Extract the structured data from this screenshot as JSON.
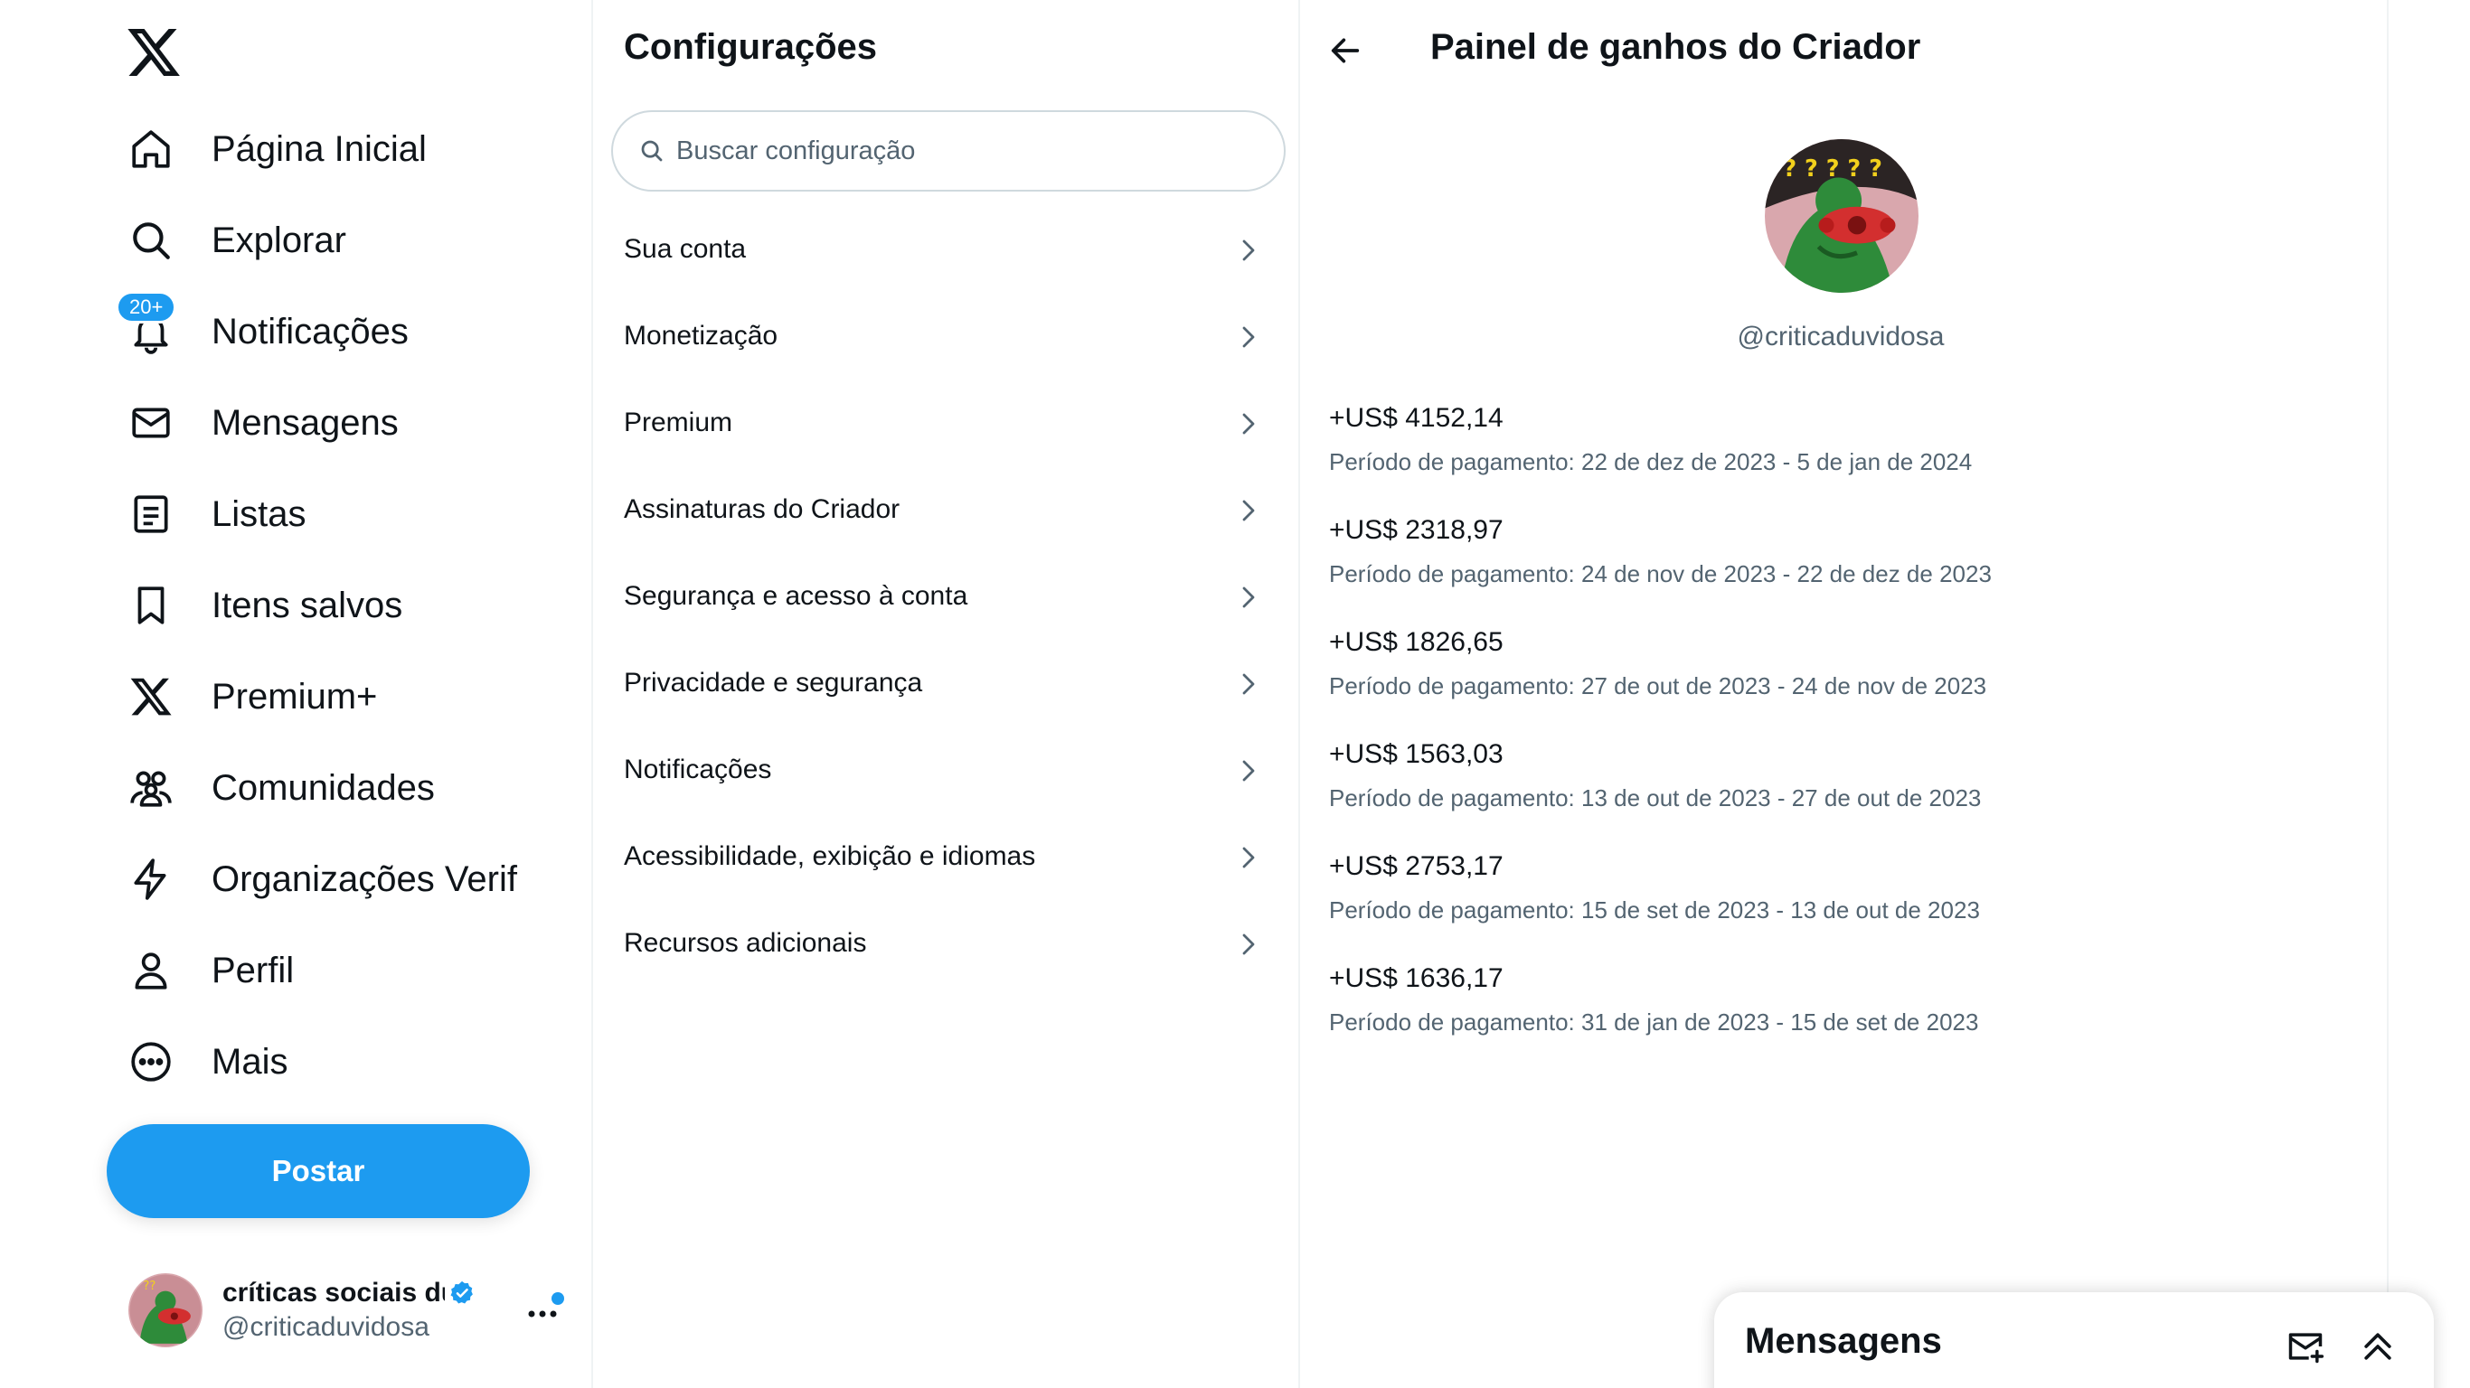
{
  "nav": {
    "items": [
      {
        "label": "Página Inicial",
        "icon": "home-icon"
      },
      {
        "label": "Explorar",
        "icon": "search-icon"
      },
      {
        "label": "Notificações",
        "icon": "bell-icon",
        "badge": "20+"
      },
      {
        "label": "Mensagens",
        "icon": "envelope-icon"
      },
      {
        "label": "Listas",
        "icon": "list-icon"
      },
      {
        "label": "Itens salvos",
        "icon": "bookmark-icon"
      },
      {
        "label": "Premium+",
        "icon": "x-logo-icon"
      },
      {
        "label": "Comunidades",
        "icon": "people-icon"
      },
      {
        "label": "Organizações Verif",
        "icon": "lightning-icon"
      },
      {
        "label": "Perfil",
        "icon": "person-icon"
      },
      {
        "label": "Mais",
        "icon": "more-circle-icon"
      }
    ],
    "post_label": "Postar",
    "account": {
      "display_name": "críticas sociais duvidosas",
      "handle": "@criticaduvidosa"
    }
  },
  "settings": {
    "title": "Configurações",
    "search_placeholder": "Buscar configuração",
    "items": [
      "Sua conta",
      "Monetização",
      "Premium",
      "Assinaturas do Criador",
      "Segurança e acesso à conta",
      "Privacidade e segurança",
      "Notificações",
      "Acessibilidade, exibição e idiomas",
      "Recursos adicionais"
    ]
  },
  "panel": {
    "title": "Painel de ganhos do Criador",
    "handle": "@criticaduvidosa",
    "earnings": [
      {
        "amount": "+US$ 4152,14",
        "period": "Período de pagamento: 22 de dez de 2023 - 5 de jan de 2024"
      },
      {
        "amount": "+US$ 2318,97",
        "period": "Período de pagamento: 24 de nov de 2023 - 22 de dez de 2023"
      },
      {
        "amount": "+US$ 1826,65",
        "period": "Período de pagamento: 27 de out de 2023 - 24 de nov de 2023"
      },
      {
        "amount": "+US$ 1563,03",
        "period": "Período de pagamento: 13 de out de 2023 - 27 de out de 2023"
      },
      {
        "amount": "+US$ 2753,17",
        "period": "Período de pagamento: 15 de set de 2023 - 13 de out de 2023"
      },
      {
        "amount": "+US$ 1636,17",
        "period": "Período de pagamento: 31 de jan de 2023 - 15 de set de 2023"
      }
    ]
  },
  "drawer": {
    "title": "Mensagens"
  },
  "colors": {
    "accent": "#1d9bf0",
    "text": "#0f1419",
    "secondary": "#536471",
    "border": "#eff3f4"
  }
}
